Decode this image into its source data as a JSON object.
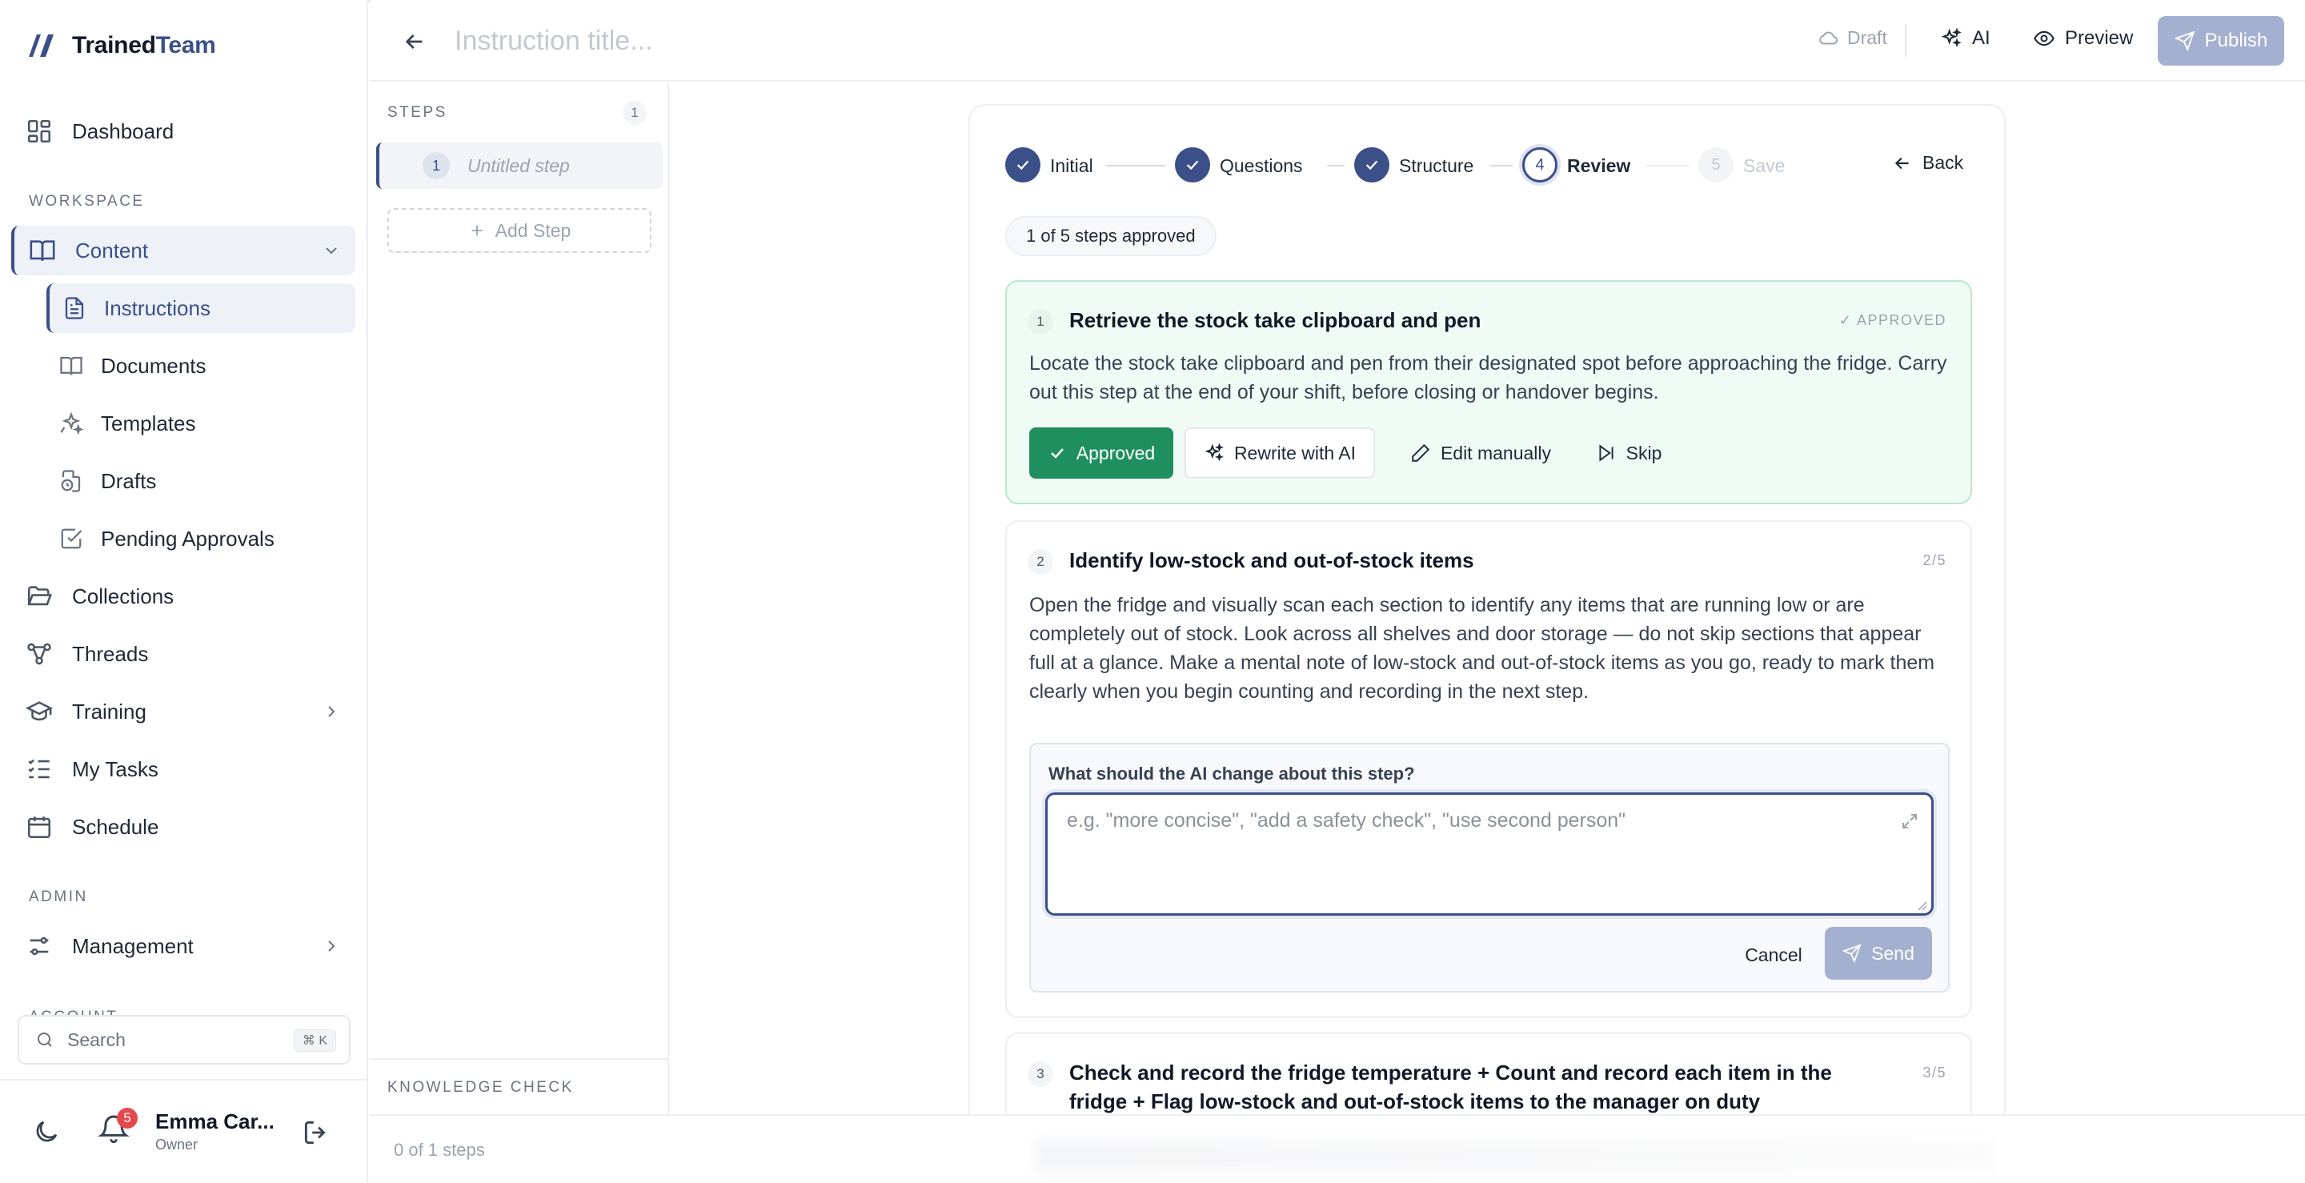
{
  "brand": {
    "name_main": "Trained",
    "name_accent": "Team"
  },
  "sidebar": {
    "dashboard": "Dashboard",
    "workspace_label": "WORKSPACE",
    "content": "Content",
    "content_sub": {
      "instructions": "Instructions",
      "documents": "Documents",
      "templates": "Templates",
      "drafts": "Drafts",
      "pending_approvals": "Pending Approvals"
    },
    "collections": "Collections",
    "threads": "Threads",
    "training": "Training",
    "my_tasks": "My Tasks",
    "schedule": "Schedule",
    "admin_label": "ADMIN",
    "management": "Management",
    "account_label": "ACCOUNT",
    "search_placeholder": "Search",
    "search_shortcut": "⌘ K",
    "notifications_count": "5",
    "user_name": "Emma Car...",
    "user_role": "Owner"
  },
  "topbar": {
    "title_placeholder": "Instruction title...",
    "draft": "Draft",
    "ai": "AI",
    "preview": "Preview",
    "publish": "Publish"
  },
  "steps_panel": {
    "label": "STEPS",
    "count": "1",
    "step_number": "1",
    "step_title": "Untitled step",
    "add_step": "Add Step",
    "knowledge_check": "KNOWLEDGE CHECK",
    "status": "0 of 1 steps"
  },
  "wizard": {
    "steps": [
      {
        "label": "Initial",
        "state": "done"
      },
      {
        "label": "Questions",
        "state": "done"
      },
      {
        "label": "Structure",
        "state": "done"
      },
      {
        "label": "Review",
        "state": "current",
        "number": "4"
      },
      {
        "label": "Save",
        "state": "future",
        "number": "5"
      }
    ],
    "back": "Back",
    "approved_summary": "1 of 5 steps approved"
  },
  "review_steps": [
    {
      "number": "1",
      "title": "Retrieve the stock take clipboard and pen",
      "tag": "✓ APPROVED",
      "body": "Locate the stock take clipboard and pen from their designated spot before approaching the fridge. Carry out this step at the end of your shift, before closing or handover begins.",
      "actions": {
        "approved": "Approved",
        "rewrite": "Rewrite with AI",
        "edit": "Edit manually",
        "skip": "Skip"
      }
    },
    {
      "number": "2",
      "title": "Identify low-stock and out-of-stock items",
      "tag": "2/5",
      "body": "Open the fridge and visually scan each section to identify any items that are running low or are completely out of stock. Look across all shelves and door storage — do not skip sections that appear full at a glance. Make a mental note of low-stock and out-of-stock items as you go, ready to mark them clearly when you begin counting and recording in the next step.",
      "ai_prompt": {
        "label": "What should the AI change about this step?",
        "placeholder": "e.g. \"more concise\", \"add a safety check\", \"use second person\"",
        "cancel": "Cancel",
        "send": "Send"
      }
    },
    {
      "number": "3",
      "title": "Check and record the fridge temperature + Count and record each item in the fridge + Flag low-stock and out-of-stock items to the manager on duty",
      "tag": "3/5"
    }
  ],
  "colors": {
    "accent": "#3b4f88",
    "approved_green": "#1f8f5f",
    "disabled_button": "#a4b0cf",
    "badge_red": "#e5484d"
  }
}
